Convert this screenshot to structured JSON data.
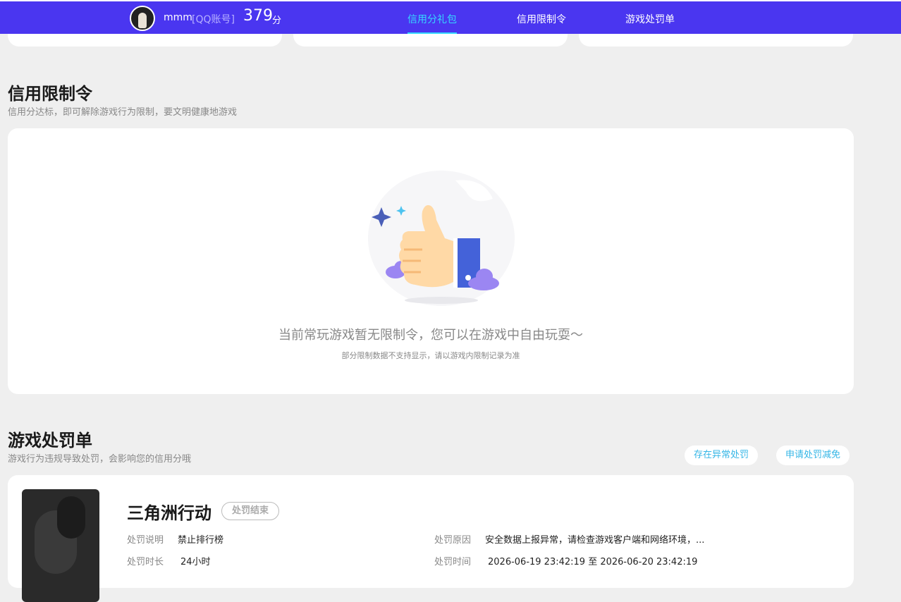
{
  "header": {
    "username": "mmm",
    "account_type": "[QQ账号]",
    "score": "379",
    "score_unit": "分",
    "tabs": [
      {
        "label": "信用分礼包",
        "active": true
      },
      {
        "label": "信用限制令",
        "active": false
      },
      {
        "label": "游戏处罚单",
        "active": false
      }
    ]
  },
  "restriction": {
    "title": "信用限制令",
    "subtitle": "信用分达标，即可解除游戏行为限制，要文明健康地游戏",
    "empty_message": "当前常玩游戏暂无限制令，您可以在游戏中自由玩耍～",
    "empty_note": "部分限制数据不支持显示，请以游戏内限制记录为准",
    "illustration_icon": "thumbs-up-icon"
  },
  "penalty": {
    "title": "游戏处罚单",
    "subtitle": "游戏行为违规导致处罚，会影响您的信用分哦",
    "btn_abnormal": "存在异常处罚",
    "btn_reduce": "申请处罚减免",
    "item": {
      "game": "三角洲行动",
      "status": "处罚结束",
      "desc_label": "处罚说明",
      "desc_value": "禁止排行榜",
      "duration_label": "处罚时长",
      "duration_value": "24小时",
      "reason_label": "处罚原因",
      "reason_value": "安全数据上报异常，请检查游戏客户端和网络环境，...",
      "time_label": "处罚时间",
      "time_value": "2026-06-19 23:42:19 至 2026-06-20 23:42:19"
    }
  },
  "colors": {
    "header_bg": "#4a36f0",
    "active_tab": "#35d8ff",
    "link_blue": "#35b6e6",
    "page_bg": "#efefef"
  }
}
